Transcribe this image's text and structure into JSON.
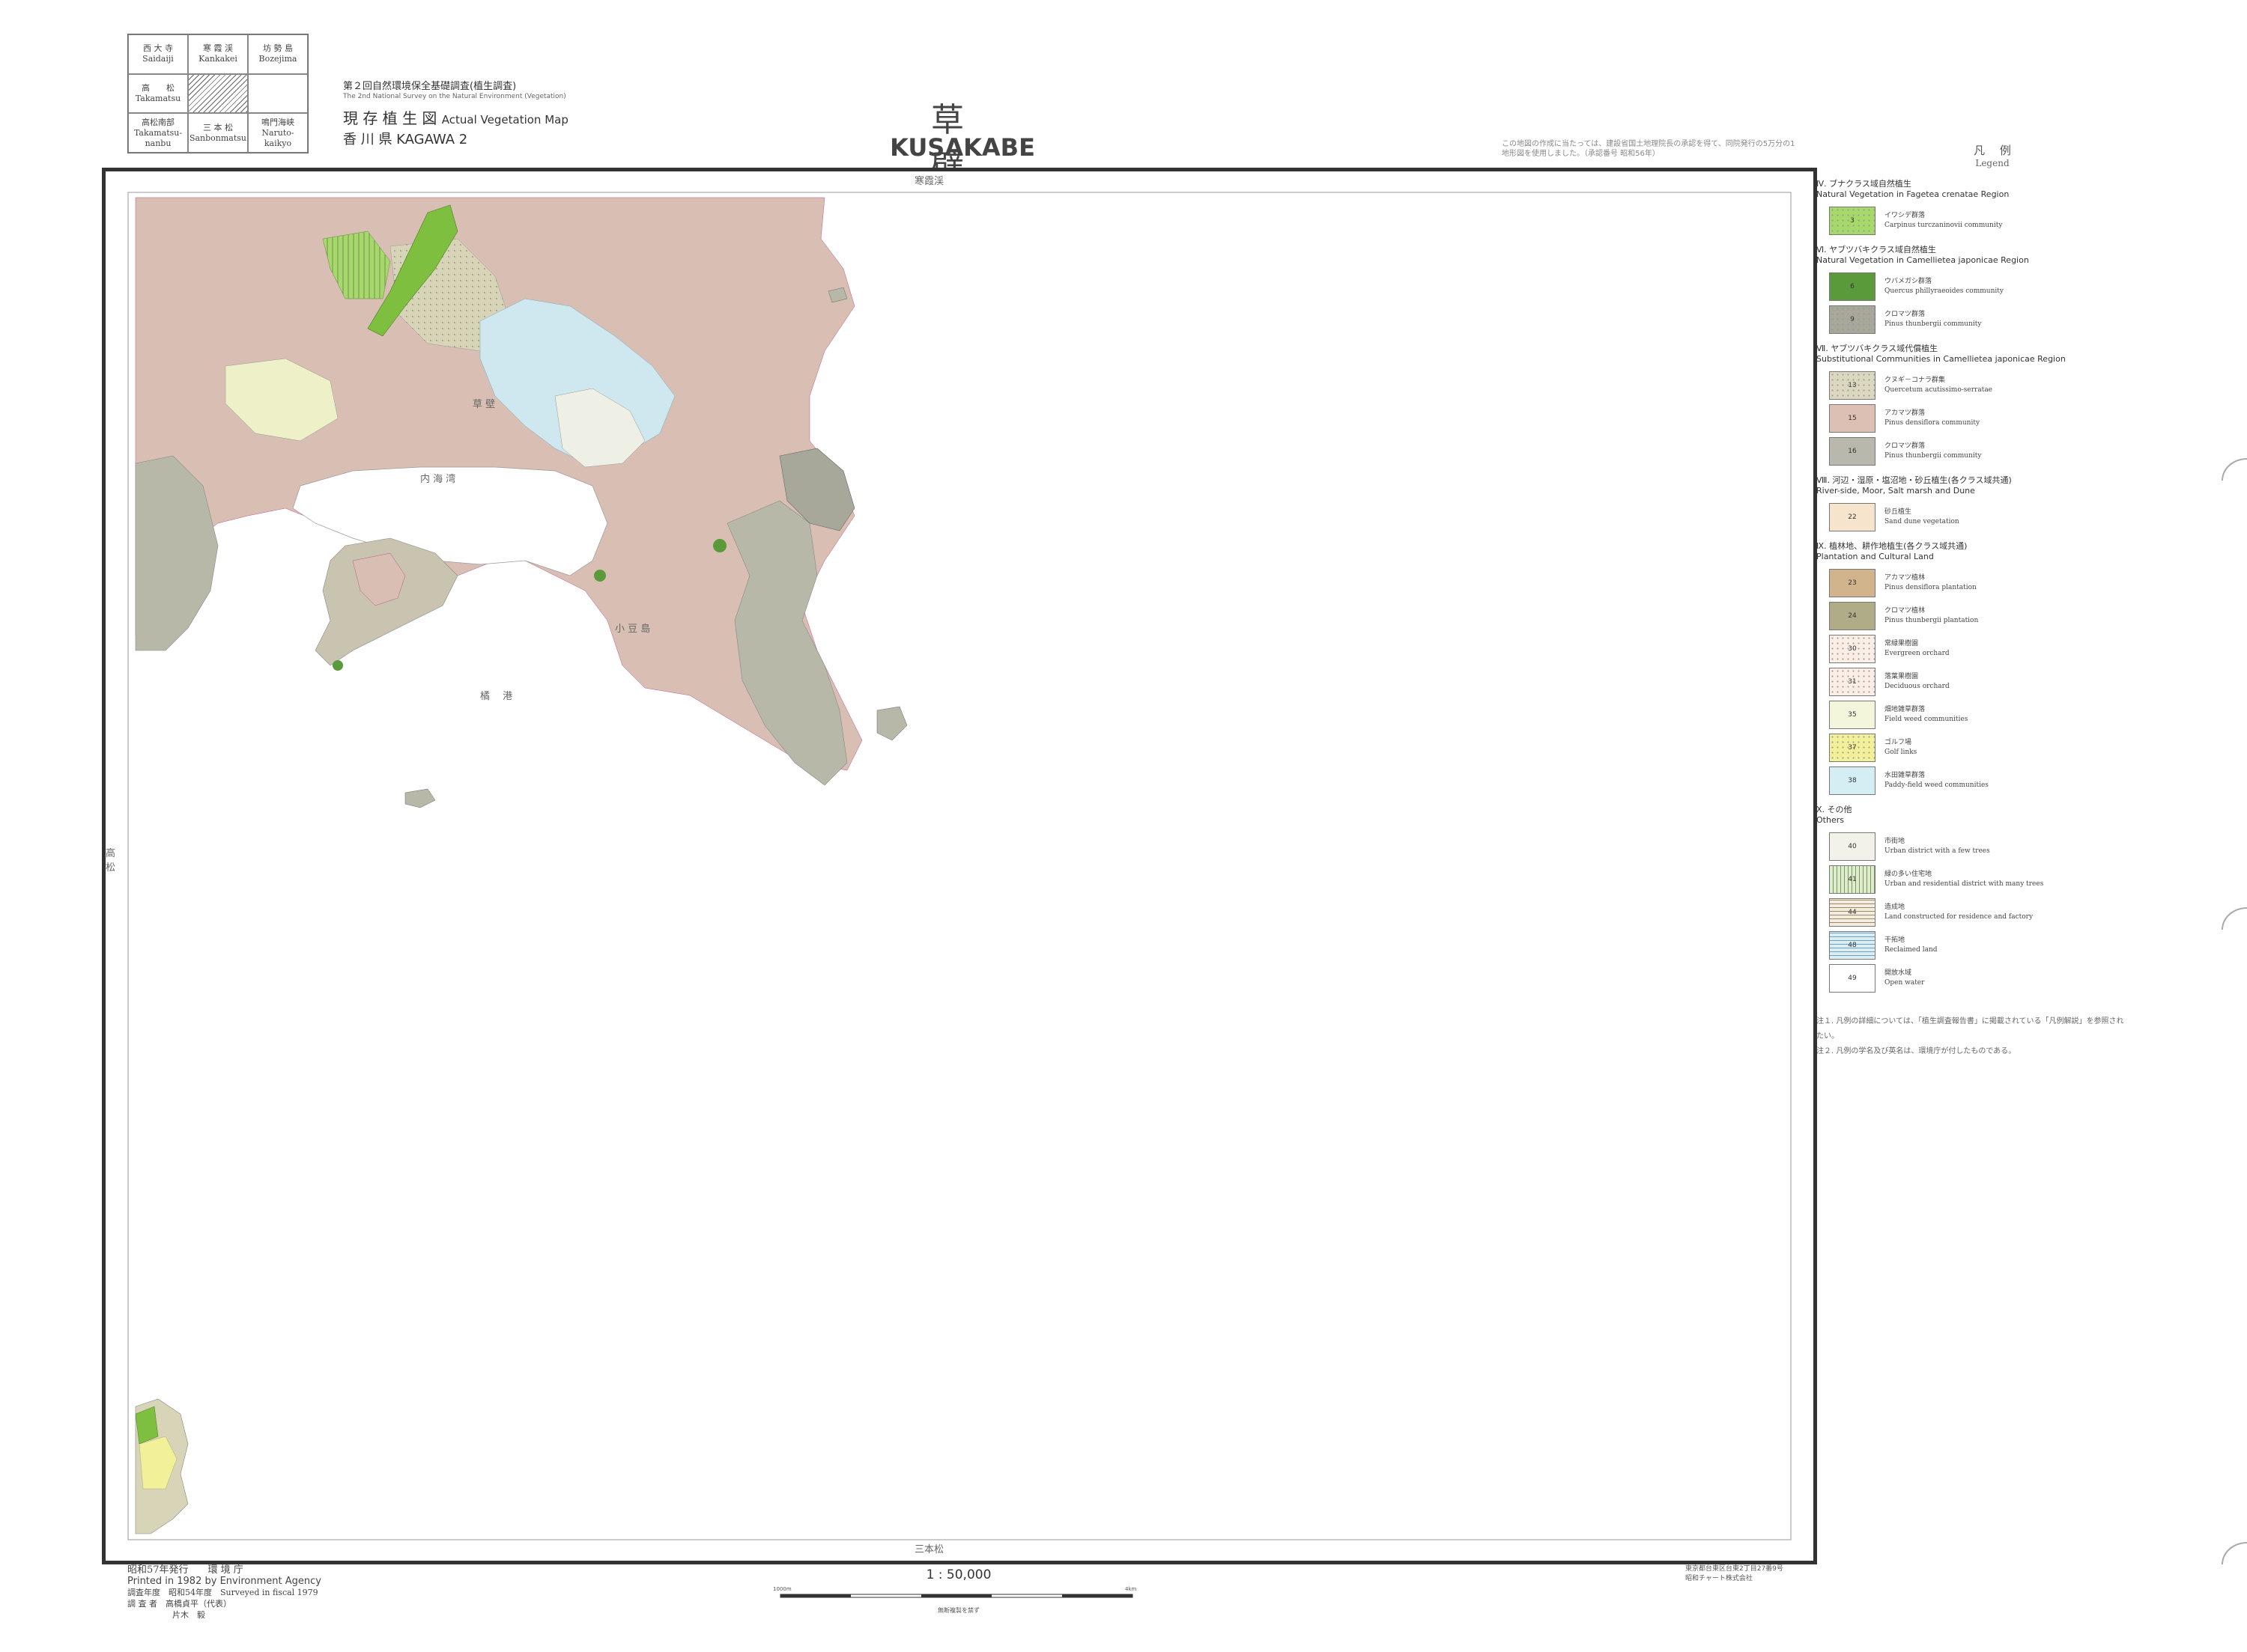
{
  "index_map": {
    "cells": [
      {
        "jp": "西 大 寺",
        "en": "Saidaiji"
      },
      {
        "jp": "寒 霞 渓",
        "en": "Kankakei"
      },
      {
        "jp": "坊 勢 島",
        "en": "Bozejima"
      },
      {
        "jp": "高　　松",
        "en": "Takamatsu"
      },
      {
        "jp": "",
        "en": ""
      },
      {
        "jp": "",
        "en": ""
      },
      {
        "jp": "高松南部",
        "en": "Takamatsu-nanbu"
      },
      {
        "jp": "三 本 松",
        "en": "Sanbonmatsu"
      },
      {
        "jp": "鳴門海峡",
        "en": "Naruto-kaikyo"
      }
    ]
  },
  "header": {
    "series_jp": "第２回自然環境保全基礎調査(植生調査)",
    "series_en": "The 2nd National Survey on the Natural Environment (Vegetation)",
    "map_type_jp": "現 存 植 生 図",
    "map_type_en": "Actual Vegetation Map",
    "prefecture": "香 川 県 KAGAWA 2",
    "title_jp": "草 壁",
    "title_en": "KUSAKABE",
    "note": "この地図の作成に当たっては、建設省国土地理院長の承認を得て、同院発行の5万分の1地形図を使用しました。（承認番号 昭和56年）"
  },
  "map": {
    "labels": {
      "top": "寒霞渓",
      "bottom": "三本松",
      "left": "高松",
      "bay1": "内 海 湾",
      "bay2": "草 壁",
      "sea": "橘 　港",
      "island1": "小 豆 島"
    },
    "colors": {
      "sea": "#ffffff",
      "pine_semi": "#d9bfb3",
      "pine_thun": "#b8b8a8",
      "quercus": "#d8d4b8",
      "green_nat": "#7fbf3f",
      "paddy": "#cfe8ef",
      "urban": "#eef0e6",
      "field": "#eef0c8",
      "plantation": "#c8b48a",
      "golf": "#f3f09a"
    }
  },
  "legend": {
    "title_jp": "凡 　例",
    "title_en": "Legend",
    "sections": [
      {
        "jp": "Ⅳ. ブナクラス域自然植生",
        "en": "Natural Vegetation in Fagetea crenatae Region",
        "items": [
          {
            "code": "3",
            "jp": "イワシデ群落",
            "en": "Carpinus turczaninovii community",
            "color": "#a6d96a",
            "pattern": "dots"
          }
        ]
      },
      {
        "jp": "Ⅵ. ヤブツバキクラス域自然植生",
        "en": "Natural Vegetation in Camellietea japonicae Region",
        "items": [
          {
            "code": "6",
            "jp": "ウバメガシ群落",
            "en": "Quercus phillyraeoides community",
            "color": "#5a9a3a",
            "pattern": "none"
          },
          {
            "code": "9",
            "jp": "クロマツ群落",
            "en": "Pinus thunbergii community",
            "color": "#a8a89a",
            "pattern": "dots"
          }
        ]
      },
      {
        "jp": "Ⅶ. ヤブツバキクラス域代償植生",
        "en": "Substitutional Communities in Camellietea japonicae Region",
        "items": [
          {
            "code": "13",
            "jp": "クヌギ－コナラ群集",
            "en": "Quercetum acutissimo-serratae",
            "color": "#dcd8c0",
            "pattern": "dots"
          },
          {
            "code": "15",
            "jp": "アカマツ群落",
            "en": "Pinus densiflora community",
            "color": "#dcc0b4",
            "pattern": "none"
          },
          {
            "code": "16",
            "jp": "クロマツ群落",
            "en": "Pinus thunbergii community",
            "color": "#b8b8ac",
            "pattern": "none"
          }
        ]
      },
      {
        "jp": "Ⅷ. 河辺・湿原・塩沼地・砂丘植生(各クラス域共通)",
        "en": "River-side, Moor, Salt marsh and Dune",
        "items": [
          {
            "code": "22",
            "jp": "砂丘植生",
            "en": "Sand dune vegetation",
            "color": "#f6e4cc",
            "pattern": "none"
          }
        ]
      },
      {
        "jp": "Ⅸ. 植林地、耕作地植生(各クラス域共通)",
        "en": "Plantation and Cultural Land",
        "items": [
          {
            "code": "23",
            "jp": "アカマツ植林",
            "en": "Pinus densiflora plantation",
            "color": "#d2b48c",
            "pattern": "none"
          },
          {
            "code": "24",
            "jp": "クロマツ植林",
            "en": "Pinus thunbergii plantation",
            "color": "#b0ac88",
            "pattern": "none"
          },
          {
            "code": "30",
            "jp": "常緑果樹園",
            "en": "Evergreen orchard",
            "color": "#fbeee6",
            "pattern": "dots"
          },
          {
            "code": "31",
            "jp": "落葉果樹園",
            "en": "Deciduous orchard",
            "color": "#fbeee6",
            "pattern": "dots"
          },
          {
            "code": "35",
            "jp": "畑地雑草群落",
            "en": "Field weed communities",
            "color": "#f4f6dc",
            "pattern": "none"
          },
          {
            "code": "37",
            "jp": "ゴルフ場",
            "en": "Golf links",
            "color": "#f3f09a",
            "pattern": "dots"
          },
          {
            "code": "38",
            "jp": "水田雑草群落",
            "en": "Paddy-field weed communities",
            "color": "#d4eef4",
            "pattern": "none"
          }
        ]
      },
      {
        "jp": "Ⅹ. その他",
        "en": "Others",
        "items": [
          {
            "code": "40",
            "jp": "市街地",
            "en": "Urban district with a few trees",
            "color": "#f2f2ea",
            "pattern": "none"
          },
          {
            "code": "41",
            "jp": "緑の多い住宅地",
            "en": "Urban and residential district with many trees",
            "color": "#e0ecd0",
            "pattern": "vlines"
          },
          {
            "code": "44",
            "jp": "造成地",
            "en": "Land constructed for residence and factory",
            "color": "#f3ece0",
            "pattern": "hlines"
          },
          {
            "code": "48",
            "jp": "干拓地",
            "en": "Reclaimed land",
            "color": "#dceef4",
            "pattern": "hlines-blue"
          },
          {
            "code": "49",
            "jp": "開放水域",
            "en": "Open water",
            "color": "#ffffff",
            "pattern": "none"
          }
        ]
      }
    ],
    "notes": [
      "注１. 凡例の詳細については、「植生調査報告書」に掲載されている「凡例解説」を参照されたい。",
      "注２. 凡例の学名及び英名は、環境庁が付したものである。"
    ]
  },
  "footer": {
    "published_jp": "昭和57年発行　　環 境 庁",
    "printed_en": "Printed in 1982 by Environment Agency",
    "survey_year": "調査年度　昭和54年度　Surveyed in fiscal 1979",
    "surveyor1": "調 査 者　高橋貞平（代表）",
    "surveyor2": "片木　毅",
    "scale": "1 : 50,000",
    "scale_start": "1000m",
    "scale_end": "4km",
    "scale_note": "無断複製を禁ず",
    "printer1": "東京都台東区台東2丁目27番9号",
    "printer2": "昭和チャート株式会社"
  }
}
